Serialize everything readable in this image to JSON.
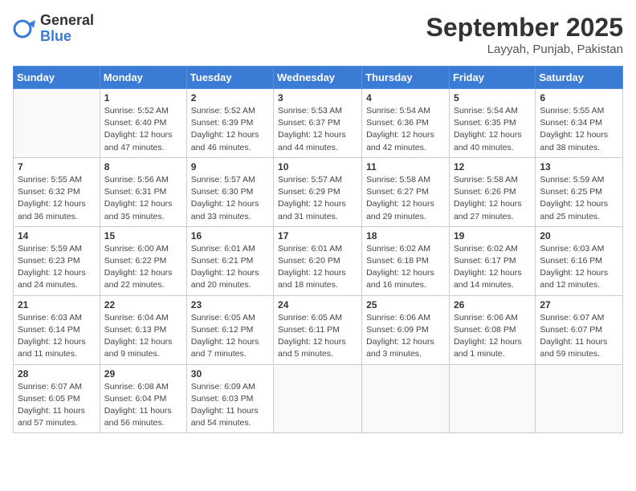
{
  "logo": {
    "general": "General",
    "blue": "Blue"
  },
  "title": "September 2025",
  "location": "Layyah, Punjab, Pakistan",
  "days_header": [
    "Sunday",
    "Monday",
    "Tuesday",
    "Wednesday",
    "Thursday",
    "Friday",
    "Saturday"
  ],
  "weeks": [
    [
      {
        "day": "",
        "info": ""
      },
      {
        "day": "1",
        "info": "Sunrise: 5:52 AM\nSunset: 6:40 PM\nDaylight: 12 hours\nand 47 minutes."
      },
      {
        "day": "2",
        "info": "Sunrise: 5:52 AM\nSunset: 6:39 PM\nDaylight: 12 hours\nand 46 minutes."
      },
      {
        "day": "3",
        "info": "Sunrise: 5:53 AM\nSunset: 6:37 PM\nDaylight: 12 hours\nand 44 minutes."
      },
      {
        "day": "4",
        "info": "Sunrise: 5:54 AM\nSunset: 6:36 PM\nDaylight: 12 hours\nand 42 minutes."
      },
      {
        "day": "5",
        "info": "Sunrise: 5:54 AM\nSunset: 6:35 PM\nDaylight: 12 hours\nand 40 minutes."
      },
      {
        "day": "6",
        "info": "Sunrise: 5:55 AM\nSunset: 6:34 PM\nDaylight: 12 hours\nand 38 minutes."
      }
    ],
    [
      {
        "day": "7",
        "info": "Sunrise: 5:55 AM\nSunset: 6:32 PM\nDaylight: 12 hours\nand 36 minutes."
      },
      {
        "day": "8",
        "info": "Sunrise: 5:56 AM\nSunset: 6:31 PM\nDaylight: 12 hours\nand 35 minutes."
      },
      {
        "day": "9",
        "info": "Sunrise: 5:57 AM\nSunset: 6:30 PM\nDaylight: 12 hours\nand 33 minutes."
      },
      {
        "day": "10",
        "info": "Sunrise: 5:57 AM\nSunset: 6:29 PM\nDaylight: 12 hours\nand 31 minutes."
      },
      {
        "day": "11",
        "info": "Sunrise: 5:58 AM\nSunset: 6:27 PM\nDaylight: 12 hours\nand 29 minutes."
      },
      {
        "day": "12",
        "info": "Sunrise: 5:58 AM\nSunset: 6:26 PM\nDaylight: 12 hours\nand 27 minutes."
      },
      {
        "day": "13",
        "info": "Sunrise: 5:59 AM\nSunset: 6:25 PM\nDaylight: 12 hours\nand 25 minutes."
      }
    ],
    [
      {
        "day": "14",
        "info": "Sunrise: 5:59 AM\nSunset: 6:23 PM\nDaylight: 12 hours\nand 24 minutes."
      },
      {
        "day": "15",
        "info": "Sunrise: 6:00 AM\nSunset: 6:22 PM\nDaylight: 12 hours\nand 22 minutes."
      },
      {
        "day": "16",
        "info": "Sunrise: 6:01 AM\nSunset: 6:21 PM\nDaylight: 12 hours\nand 20 minutes."
      },
      {
        "day": "17",
        "info": "Sunrise: 6:01 AM\nSunset: 6:20 PM\nDaylight: 12 hours\nand 18 minutes."
      },
      {
        "day": "18",
        "info": "Sunrise: 6:02 AM\nSunset: 6:18 PM\nDaylight: 12 hours\nand 16 minutes."
      },
      {
        "day": "19",
        "info": "Sunrise: 6:02 AM\nSunset: 6:17 PM\nDaylight: 12 hours\nand 14 minutes."
      },
      {
        "day": "20",
        "info": "Sunrise: 6:03 AM\nSunset: 6:16 PM\nDaylight: 12 hours\nand 12 minutes."
      }
    ],
    [
      {
        "day": "21",
        "info": "Sunrise: 6:03 AM\nSunset: 6:14 PM\nDaylight: 12 hours\nand 11 minutes."
      },
      {
        "day": "22",
        "info": "Sunrise: 6:04 AM\nSunset: 6:13 PM\nDaylight: 12 hours\nand 9 minutes."
      },
      {
        "day": "23",
        "info": "Sunrise: 6:05 AM\nSunset: 6:12 PM\nDaylight: 12 hours\nand 7 minutes."
      },
      {
        "day": "24",
        "info": "Sunrise: 6:05 AM\nSunset: 6:11 PM\nDaylight: 12 hours\nand 5 minutes."
      },
      {
        "day": "25",
        "info": "Sunrise: 6:06 AM\nSunset: 6:09 PM\nDaylight: 12 hours\nand 3 minutes."
      },
      {
        "day": "26",
        "info": "Sunrise: 6:06 AM\nSunset: 6:08 PM\nDaylight: 12 hours\nand 1 minute."
      },
      {
        "day": "27",
        "info": "Sunrise: 6:07 AM\nSunset: 6:07 PM\nDaylight: 11 hours\nand 59 minutes."
      }
    ],
    [
      {
        "day": "28",
        "info": "Sunrise: 6:07 AM\nSunset: 6:05 PM\nDaylight: 11 hours\nand 57 minutes."
      },
      {
        "day": "29",
        "info": "Sunrise: 6:08 AM\nSunset: 6:04 PM\nDaylight: 11 hours\nand 56 minutes."
      },
      {
        "day": "30",
        "info": "Sunrise: 6:09 AM\nSunset: 6:03 PM\nDaylight: 11 hours\nand 54 minutes."
      },
      {
        "day": "",
        "info": ""
      },
      {
        "day": "",
        "info": ""
      },
      {
        "day": "",
        "info": ""
      },
      {
        "day": "",
        "info": ""
      }
    ]
  ]
}
